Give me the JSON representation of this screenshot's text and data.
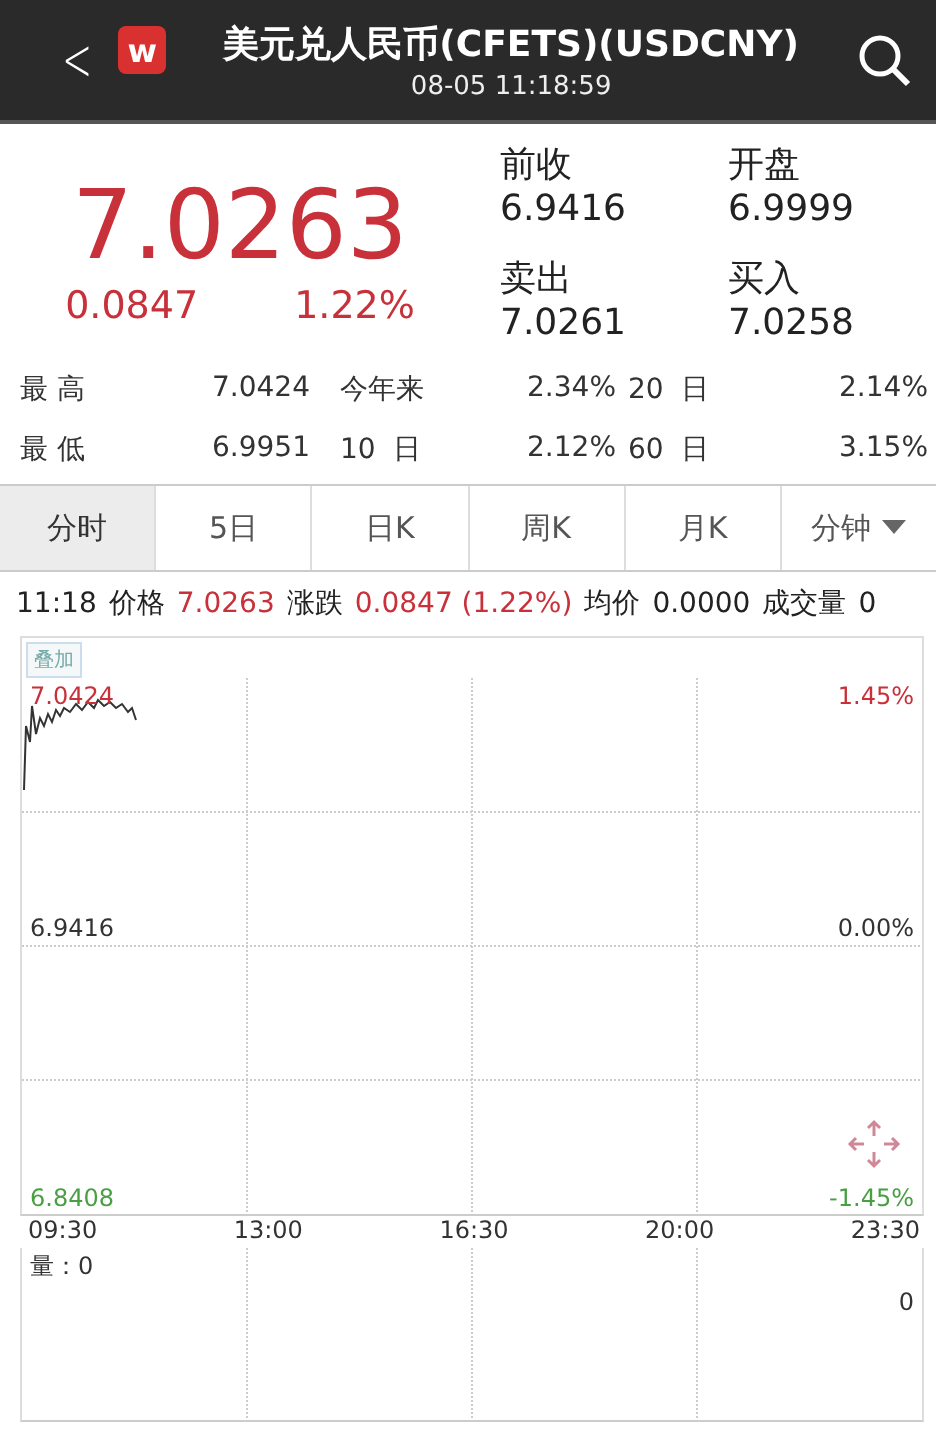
{
  "header": {
    "back": "<",
    "logo": "w",
    "title": "美元兑人民币(CFETS)(USDCNY)",
    "time": "08-05 11:18:59"
  },
  "quote": {
    "price": "7.0263",
    "change": "0.0847",
    "percent": "1.22%",
    "color": "#c8303a",
    "fields": [
      {
        "label": "前收",
        "value": "6.9416"
      },
      {
        "label": "开盘",
        "value": "6.9999"
      },
      {
        "label": "卖出",
        "value": "7.0261"
      },
      {
        "label": "买入",
        "value": "7.0258"
      }
    ]
  },
  "stats": [
    [
      "最 高",
      "7.0424",
      "今年来",
      "2.34%",
      "20  日",
      "2.14%"
    ],
    [
      "最 低",
      "6.9951",
      "10  日",
      "2.12%",
      "60  日",
      "3.15%"
    ]
  ],
  "tabs": [
    {
      "label": "分时",
      "selected": true,
      "dropdown": false
    },
    {
      "label": "5日",
      "selected": false,
      "dropdown": false
    },
    {
      "label": "日K",
      "selected": false,
      "dropdown": false
    },
    {
      "label": "周K",
      "selected": false,
      "dropdown": false
    },
    {
      "label": "月K",
      "selected": false,
      "dropdown": false
    },
    {
      "label": "分钟",
      "selected": false,
      "dropdown": true
    }
  ],
  "info": {
    "time": "11:18",
    "items": [
      {
        "label": "价格",
        "value": "7.0263",
        "color": "#c8303a"
      },
      {
        "label": "涨跌",
        "value": "0.0847 (1.22%)",
        "color": "#c8303a"
      },
      {
        "label": "均价",
        "value": "0.0000",
        "color": "#222222"
      },
      {
        "label": "成交量",
        "value": "0",
        "color": "#222222"
      }
    ]
  },
  "chart": {
    "overlay_button": "叠加",
    "high": "7.0424",
    "high_pct": "1.45%",
    "mid": "6.9416",
    "mid_pct": "0.00%",
    "low": "6.8408",
    "low_pct": "-1.45%",
    "times": [
      "09:30",
      "13:00",
      "16:30",
      "20:00",
      "23:30"
    ],
    "volume_label": "量：0",
    "volume_max": "0"
  }
}
